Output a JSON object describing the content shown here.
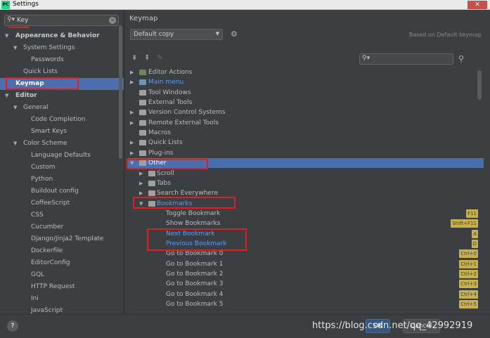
{
  "window": {
    "title": "Settings",
    "app_badge": "PC",
    "close_glyph": "✕"
  },
  "search": {
    "value": "Key"
  },
  "sidebar": {
    "items": [
      {
        "label": "Appearance & Behavior",
        "level": 0,
        "expanded": true,
        "bold": true
      },
      {
        "label": "System Settings",
        "level": 1,
        "expanded": true
      },
      {
        "label": "Passwords",
        "level": 2
      },
      {
        "label": "Quick Lists",
        "level": 1
      },
      {
        "label": "Keymap",
        "level": 0,
        "bold": true,
        "selected": true
      },
      {
        "label": "Editor",
        "level": 0,
        "expanded": true,
        "bold": true
      },
      {
        "label": "General",
        "level": 1,
        "expanded": true
      },
      {
        "label": "Code Completion",
        "level": 2
      },
      {
        "label": "Smart Keys",
        "level": 2
      },
      {
        "label": "Color Scheme",
        "level": 1,
        "expanded": true
      },
      {
        "label": "Language Defaults",
        "level": 2
      },
      {
        "label": "Custom",
        "level": 2
      },
      {
        "label": "Python",
        "level": 2
      },
      {
        "label": "Buildout config",
        "level": 2
      },
      {
        "label": "CoffeeScript",
        "level": 2
      },
      {
        "label": "CSS",
        "level": 2
      },
      {
        "label": "Cucumber",
        "level": 2
      },
      {
        "label": "Django/Jinja2 Template",
        "level": 2
      },
      {
        "label": "Dockerfile",
        "level": 2
      },
      {
        "label": "EditorConfig",
        "level": 2
      },
      {
        "label": "GQL",
        "level": 2
      },
      {
        "label": "HTTP Request",
        "level": 2
      },
      {
        "label": "Ini",
        "level": 2
      },
      {
        "label": "JavaScript",
        "level": 2
      }
    ]
  },
  "main": {
    "title": "Keymap",
    "keymap_value": "Default copy",
    "based_on": "Based on Default keymap",
    "rows": [
      {
        "label": "Editor Actions",
        "level": 0,
        "arrow": "right",
        "icon": "action"
      },
      {
        "label": "Main menu",
        "level": 0,
        "arrow": "right",
        "icon": "menu",
        "blue": true
      },
      {
        "label": "Tool Windows",
        "level": 0,
        "icon": "folder"
      },
      {
        "label": "External Tools",
        "level": 0,
        "icon": "folder"
      },
      {
        "label": "Version Control Systems",
        "level": 0,
        "arrow": "right",
        "icon": "folder"
      },
      {
        "label": "Remote External Tools",
        "level": 0,
        "arrow": "right",
        "icon": "folder"
      },
      {
        "label": "Macros",
        "level": 0,
        "icon": "folder"
      },
      {
        "label": "Quick Lists",
        "level": 0,
        "arrow": "right",
        "icon": "folder"
      },
      {
        "label": "Plug-ins",
        "level": 0,
        "arrow": "right",
        "icon": "folder"
      },
      {
        "label": "Other",
        "level": 0,
        "arrow": "down",
        "icon": "folder",
        "selected": true
      },
      {
        "label": "Scroll",
        "level": 1,
        "arrow": "right",
        "icon": "folder"
      },
      {
        "label": "Tabs",
        "level": 1,
        "arrow": "right",
        "icon": "folder"
      },
      {
        "label": "Search Everywhere",
        "level": 1,
        "arrow": "right",
        "icon": "folder"
      },
      {
        "label": "Bookmarks",
        "level": 1,
        "arrow": "down",
        "icon": "folder",
        "blue": true
      },
      {
        "label": "Toggle Bookmark",
        "level": 2,
        "shortcut": "F11"
      },
      {
        "label": "Show Bookmarks",
        "level": 2,
        "shortcut": "Shift+F11"
      },
      {
        "label": "Next Bookmark",
        "level": 2,
        "blue": true,
        "shortcut": "A"
      },
      {
        "label": "Previous Bookmark",
        "level": 2,
        "blue": true,
        "shortcut": "D"
      },
      {
        "label": "Go to Bookmark 0",
        "level": 2,
        "shortcut": "Ctrl+0"
      },
      {
        "label": "Go to Bookmark 1",
        "level": 2,
        "shortcut": "Ctrl+1"
      },
      {
        "label": "Go to Bookmark 2",
        "level": 2,
        "shortcut": "Ctrl+2"
      },
      {
        "label": "Go to Bookmark 3",
        "level": 2,
        "shortcut": "Ctrl+3"
      },
      {
        "label": "Go to Bookmark 4",
        "level": 2,
        "shortcut": "Ctrl+4"
      },
      {
        "label": "Go to Bookmark 5",
        "level": 2,
        "shortcut": "Ctrl+5"
      }
    ]
  },
  "footer": {
    "help": "?",
    "ok_label": "OK",
    "cancel_label": "Cancel"
  },
  "watermark": "https://blog.csdn.net/qq_42992919",
  "colors": {
    "accent": "#4b6eaf",
    "highlight": "#e02020",
    "shortcut_badge": "#c9b14a",
    "link_blue": "#589df6"
  }
}
